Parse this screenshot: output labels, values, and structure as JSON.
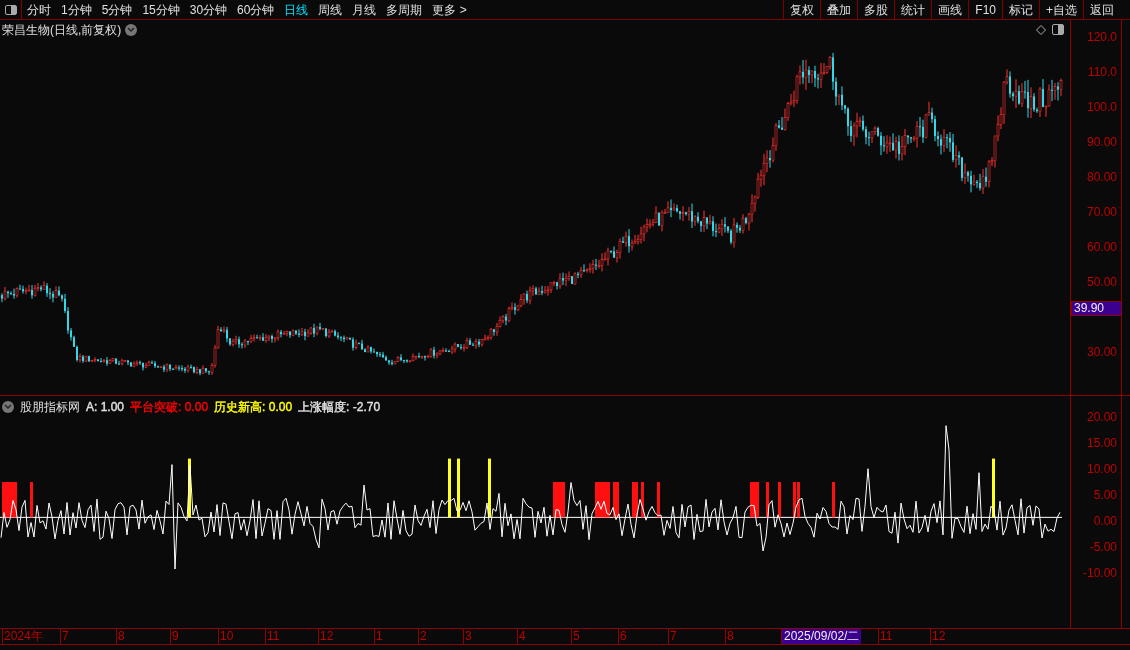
{
  "toolbar": {
    "periods": [
      {
        "label": "分时",
        "selected": false
      },
      {
        "label": "1分钟",
        "selected": false
      },
      {
        "label": "5分钟",
        "selected": false
      },
      {
        "label": "15分钟",
        "selected": false
      },
      {
        "label": "30分钟",
        "selected": false
      },
      {
        "label": "60分钟",
        "selected": false
      },
      {
        "label": "日线",
        "selected": true
      },
      {
        "label": "周线",
        "selected": false
      },
      {
        "label": "月线",
        "selected": false
      },
      {
        "label": "多周期",
        "selected": false
      },
      {
        "label": "更多 >",
        "selected": false
      }
    ],
    "actions": [
      "复权",
      "叠加",
      "多股",
      "统计",
      "画线",
      "F10",
      "标记",
      "+自选",
      "返回"
    ]
  },
  "chart": {
    "title": "荣昌生物(日线,前复权)",
    "price_axis": [
      "120.0",
      "110.0",
      "100.0",
      "90.00",
      "80.00",
      "70.00",
      "60.00",
      "50.00",
      "30.00"
    ],
    "current_price": "39.90"
  },
  "indicator": {
    "name": "股朋指标网",
    "values": [
      {
        "text": "A: 1.00",
        "color": "#e0e0e0"
      },
      {
        "text": "平台突破: 0.00",
        "color": "#ff0000"
      },
      {
        "text": "历史新高: 0.00",
        "color": "#ffff00"
      },
      {
        "text": "上涨幅度: -2.70",
        "color": "#e0e0e0"
      }
    ],
    "axis": [
      "20.00",
      "15.00",
      "10.00",
      "5.00",
      "0.00",
      "-5.00",
      "-10.00"
    ]
  },
  "date_axis": {
    "labels": [
      {
        "text": "2024年",
        "selected": false
      },
      {
        "text": "7",
        "selected": false
      },
      {
        "text": "8",
        "selected": false
      },
      {
        "text": "9",
        "selected": false
      },
      {
        "text": "10",
        "selected": false
      },
      {
        "text": "11",
        "selected": false
      },
      {
        "text": "12",
        "selected": false
      },
      {
        "text": "1",
        "selected": false
      },
      {
        "text": "2",
        "selected": false
      },
      {
        "text": "3",
        "selected": false
      },
      {
        "text": "4",
        "selected": false
      },
      {
        "text": "5",
        "selected": false
      },
      {
        "text": "6",
        "selected": false
      },
      {
        "text": "7",
        "selected": false
      },
      {
        "text": "8",
        "selected": false
      },
      {
        "text": "2025/09/02/二",
        "selected": true
      },
      {
        "text": "11",
        "selected": false
      },
      {
        "text": "12",
        "selected": false
      }
    ]
  }
}
